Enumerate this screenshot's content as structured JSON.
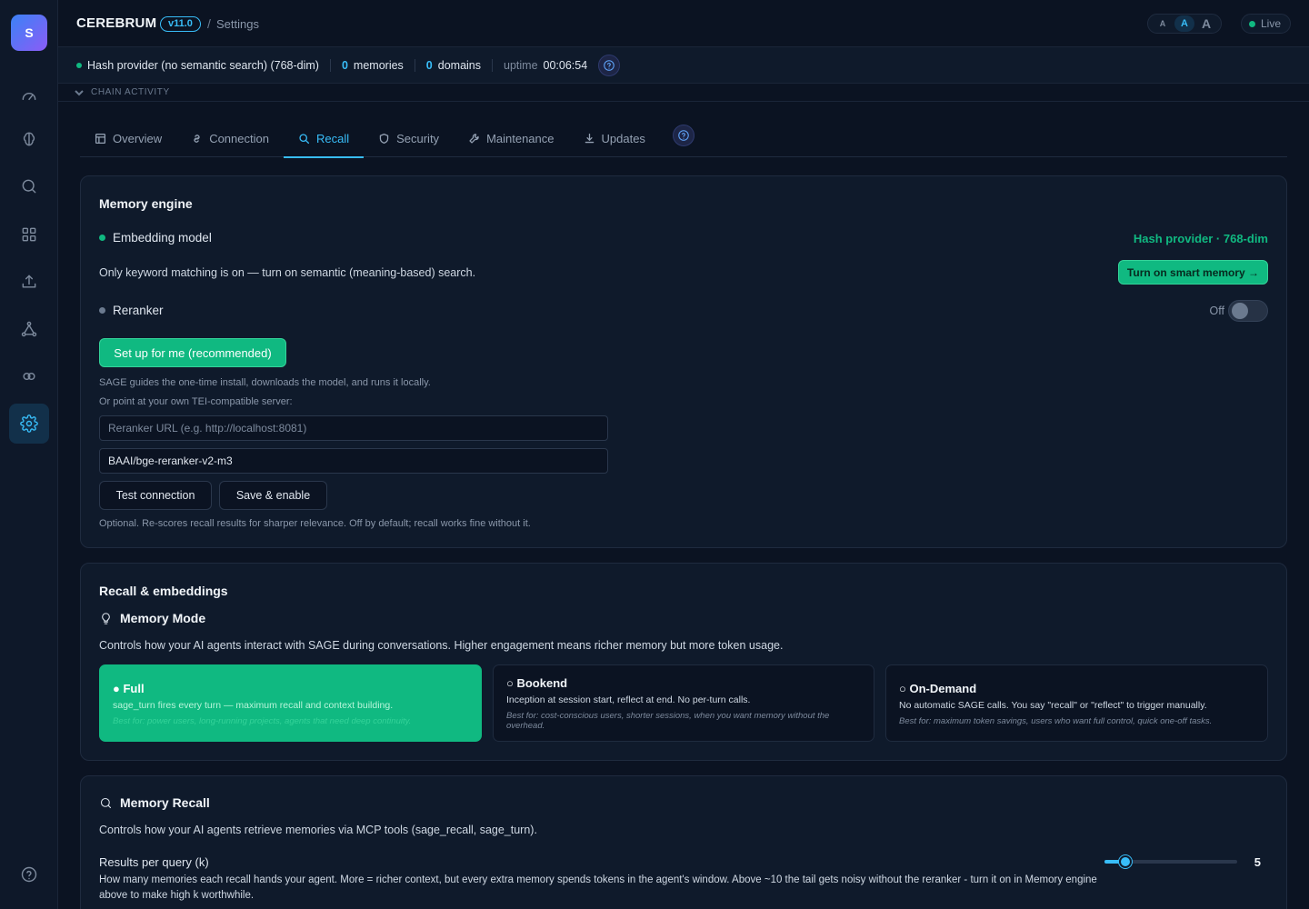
{
  "sidebar": {
    "logo_letter": "S",
    "items": [
      {
        "icon": "gauge-icon"
      },
      {
        "icon": "brain-icon"
      },
      {
        "icon": "search-icon"
      },
      {
        "icon": "grid-icon"
      },
      {
        "icon": "upload-icon"
      },
      {
        "icon": "network-icon"
      },
      {
        "icon": "link-icon"
      },
      {
        "icon": "gear-icon",
        "active": true
      }
    ],
    "help_icon": "help-icon"
  },
  "header": {
    "brand": "CEREBRUM",
    "version": "v11.0",
    "separator": "/",
    "breadcrumb": "Settings",
    "font_sizes": [
      "A",
      "A",
      "A"
    ],
    "live_label": "Live"
  },
  "status": {
    "provider": "Hash provider (no semantic search) (768-dim)",
    "memories_count": "0",
    "memories_label": "memories",
    "domains_count": "0",
    "domains_label": "domains",
    "uptime_label": "uptime",
    "uptime_value": "00:06:54"
  },
  "chain_activity": "CHAIN ACTIVITY",
  "tabs": [
    {
      "label": "Overview",
      "icon": "grid-icon"
    },
    {
      "label": "Connection",
      "icon": "link-icon"
    },
    {
      "label": "Recall",
      "icon": "search-icon",
      "active": true
    },
    {
      "label": "Security",
      "icon": "shield-icon"
    },
    {
      "label": "Maintenance",
      "icon": "wrench-icon"
    },
    {
      "label": "Updates",
      "icon": "download-icon"
    }
  ],
  "memory_engine": {
    "title": "Memory engine",
    "embedding_label": "Embedding model",
    "embedding_value": "Hash provider · 768-dim",
    "keyword_notice": "Only keyword matching is on — turn on semantic (meaning-based) search.",
    "smart_memory_button": "Turn on smart memory →",
    "reranker_label": "Reranker",
    "reranker_state": "Off",
    "setup_button": "Set up for me (recommended)",
    "setup_help": "SAGE guides the one-time install, downloads the model, and runs it locally.",
    "own_server_help": "Or point at your own TEI-compatible server:",
    "url_placeholder": "Reranker URL (e.g. http://localhost:8081)",
    "model_value": "BAAI/bge-reranker-v2-m3",
    "test_button": "Test connection",
    "save_button": "Save & enable",
    "optional_note": "Optional. Re-scores recall results for sharper relevance. Off by default; recall works fine without it."
  },
  "recall_embeddings": {
    "title": "Recall & embeddings",
    "mode_title": "Memory Mode",
    "mode_desc": "Controls how your AI agents interact with SAGE during conversations. Higher engagement means richer memory but more token usage.",
    "modes": [
      {
        "name": "● Full",
        "desc": "sage_turn fires every turn — maximum recall and context building.",
        "best": "Best for: power users, long-running projects, agents that need deep continuity.",
        "active": true
      },
      {
        "name": "○ Bookend",
        "desc": "Inception at session start, reflect at end. No per-turn calls.",
        "best": "Best for: cost-conscious users, shorter sessions, when you want memory without the overhead."
      },
      {
        "name": "○ On-Demand",
        "desc": "No automatic SAGE calls. You say \"recall\" or \"reflect\" to trigger manually.",
        "best": "Best for: maximum token savings, users who want full control, quick one-off tasks."
      }
    ]
  },
  "memory_recall": {
    "title": "Memory Recall",
    "desc": "Controls how your AI agents retrieve memories via MCP tools (sage_recall, sage_turn).",
    "k_label": "Results per query (k)",
    "k_help": "How many memories each recall hands your agent. More = richer context, but every extra memory spends tokens in the agent's window. Above ~10 the tail gets noisy without the reranker - turn it on in Memory engine above to make high k worthwhile.",
    "k_value": "5",
    "k_min": 1,
    "k_max": 20,
    "k_fraction": 0.16
  },
  "colors": {
    "accent": "#38bdf8",
    "success": "#10b981",
    "background": "#0b1322",
    "card": "#0f1a2b"
  }
}
